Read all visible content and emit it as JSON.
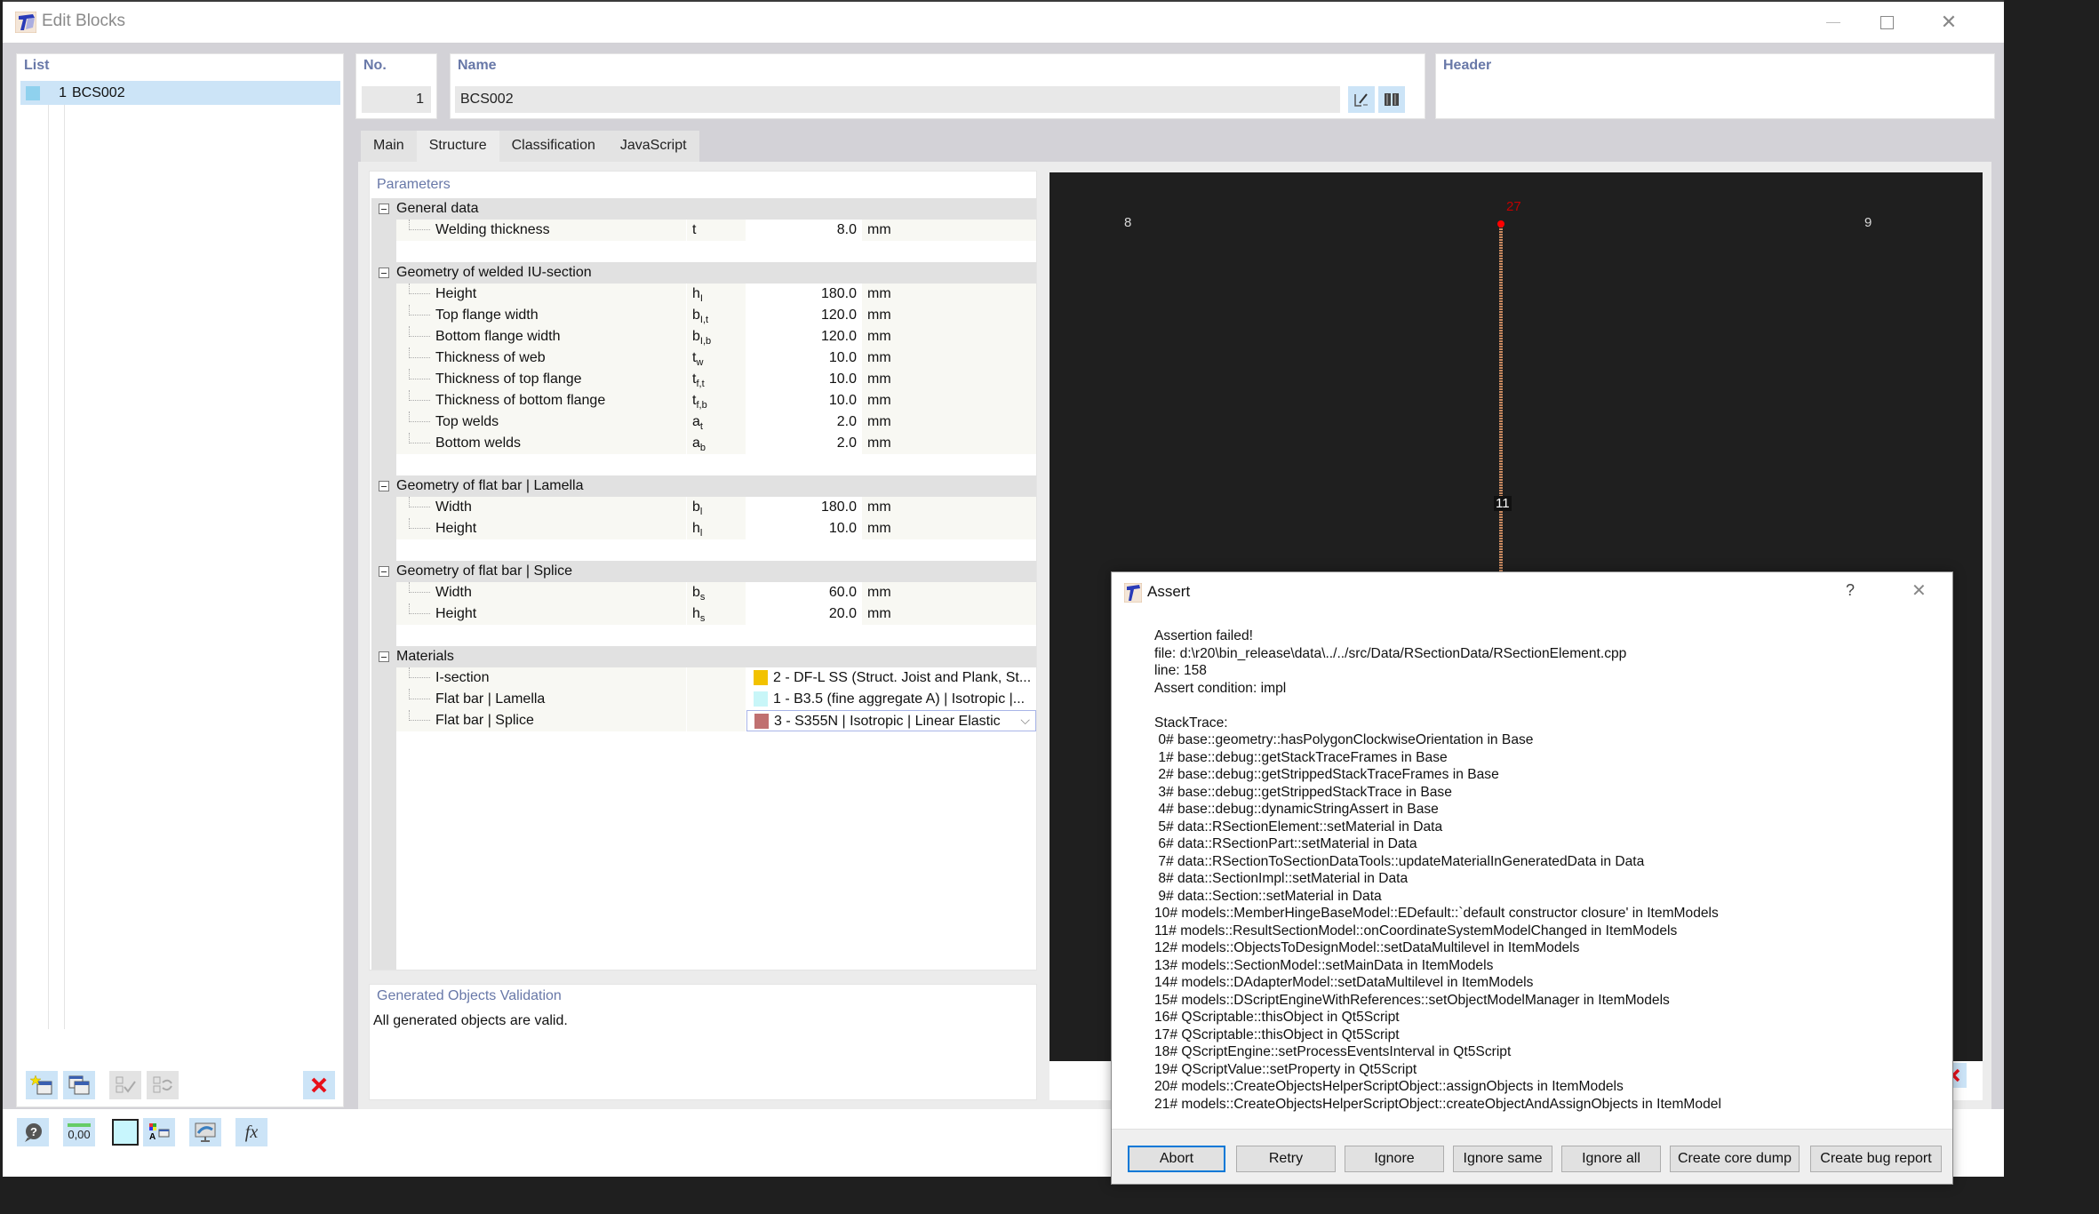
{
  "window": {
    "title": "Edit Blocks",
    "controls": [
      "minimize",
      "maximize",
      "close"
    ]
  },
  "list": {
    "label": "List",
    "items": [
      {
        "number": "1",
        "name": "BCS002",
        "color": "#8fd1ee"
      }
    ],
    "toolbar": [
      {
        "icon": "new-item-icon",
        "enabled": true
      },
      {
        "icon": "copy-item-icon",
        "enabled": true
      },
      {
        "icon": "check-all-icon",
        "enabled": false
      },
      {
        "icon": "toggle-selection-icon",
        "enabled": false
      },
      {
        "icon": "delete-icon",
        "enabled": true
      }
    ]
  },
  "fields": {
    "no_label": "No.",
    "no_value": "1",
    "name_label": "Name",
    "name_value": "BCS002",
    "header_label": "Header"
  },
  "tabs": [
    {
      "label": "Main",
      "active": false
    },
    {
      "label": "Structure",
      "active": true
    },
    {
      "label": "Classification",
      "active": false
    },
    {
      "label": "JavaScript",
      "active": false
    }
  ],
  "parameters": {
    "label": "Parameters",
    "groups": [
      {
        "title": "General data",
        "rows": [
          {
            "label": "Welding thickness",
            "symbol": "t",
            "sub": "",
            "value": "8.0",
            "unit": "mm"
          }
        ]
      },
      {
        "title": "Geometry of welded IU-section",
        "rows": [
          {
            "label": "Height",
            "symbol": "h",
            "sub": "I",
            "value": "180.0",
            "unit": "mm"
          },
          {
            "label": "Top flange width",
            "symbol": "b",
            "sub": "I,t",
            "value": "120.0",
            "unit": "mm"
          },
          {
            "label": "Bottom flange width",
            "symbol": "b",
            "sub": "I,b",
            "value": "120.0",
            "unit": "mm"
          },
          {
            "label": "Thickness of web",
            "symbol": "t",
            "sub": "w",
            "value": "10.0",
            "unit": "mm"
          },
          {
            "label": "Thickness of top flange",
            "symbol": "t",
            "sub": "f,t",
            "value": "10.0",
            "unit": "mm"
          },
          {
            "label": "Thickness of bottom flange",
            "symbol": "t",
            "sub": "f,b",
            "value": "10.0",
            "unit": "mm"
          },
          {
            "label": "Top welds",
            "symbol": "a",
            "sub": "t",
            "value": "2.0",
            "unit": "mm"
          },
          {
            "label": "Bottom welds",
            "symbol": "a",
            "sub": "b",
            "value": "2.0",
            "unit": "mm"
          }
        ]
      },
      {
        "title": "Geometry of flat bar | Lamella",
        "rows": [
          {
            "label": "Width",
            "symbol": "b",
            "sub": "l",
            "value": "180.0",
            "unit": "mm"
          },
          {
            "label": "Height",
            "symbol": "h",
            "sub": "l",
            "value": "10.0",
            "unit": "mm"
          }
        ]
      },
      {
        "title": "Geometry of flat bar | Splice",
        "rows": [
          {
            "label": "Width",
            "symbol": "b",
            "sub": "s",
            "value": "60.0",
            "unit": "mm"
          },
          {
            "label": "Height",
            "symbol": "h",
            "sub": "s",
            "value": "20.0",
            "unit": "mm"
          }
        ]
      },
      {
        "title": "Materials",
        "materials": [
          {
            "label": "I-section",
            "value": "2 - DF-L SS (Struct. Joist and Plank, St...",
            "color": "#f2c200",
            "selected": false
          },
          {
            "label": "Flat bar | Lamella",
            "value": "1 - B3.5 (fine aggregate A) | Isotropic |...",
            "color": "#c8f6f8",
            "selected": false
          },
          {
            "label": "Flat bar | Splice",
            "value": "3 - S355N | Isotropic | Linear Elastic",
            "color": "#c07070",
            "selected": true
          }
        ]
      }
    ]
  },
  "validation": {
    "label": "Generated Objects Validation",
    "message": "All generated objects are valid."
  },
  "viewport": {
    "nodes": [
      {
        "id": "8",
        "color": "#d8d8d8"
      },
      {
        "id": "27",
        "color": "#c00000"
      },
      {
        "id": "9",
        "color": "#d8d8d8"
      },
      {
        "id": "11",
        "color": "#ffffff"
      }
    ],
    "member_color": "#c98a60",
    "selected_node_color": "#ff0000"
  },
  "bottom_toolbar": [
    {
      "icon": "help-icon"
    },
    {
      "icon": "decimal-places-icon",
      "text": "0,00"
    },
    {
      "icon": "color-swatch-icon"
    },
    {
      "icon": "display-properties-icon"
    },
    {
      "icon": "view-3d-icon"
    },
    {
      "icon": "formula-icon",
      "text": "fx"
    }
  ],
  "assert_dialog": {
    "title": "Assert",
    "help": "?",
    "lines": [
      "Assertion failed!",
      "file: d:\\r20\\bin_release\\data\\../../src/Data/RSectionData/RSectionElement.cpp",
      "line: 158",
      "Assert condition: impl",
      "",
      "StackTrace:",
      " 0# base::geometry::hasPolygonClockwiseOrientation in Base",
      " 1# base::debug::getStackTraceFrames in Base",
      " 2# base::debug::getStrippedStackTraceFrames in Base",
      " 3# base::debug::getStrippedStackTrace in Base",
      " 4# base::debug::dynamicStringAssert in Base",
      " 5# data::RSectionElement::setMaterial in Data",
      " 6# data::RSectionPart::setMaterial in Data",
      " 7# data::RSectionToSectionDataTools::updateMaterialInGeneratedData in Data",
      " 8# data::SectionImpl::setMaterial in Data",
      " 9# data::Section::setMaterial in Data",
      "10# models::MemberHingeBaseModel::EDefault::`default constructor closure' in ItemModels",
      "11# models::ResultSectionModel::onCoordinateSystemModelChanged in ItemModels",
      "12# models::ObjectsToDesignModel::setDataMultilevel in ItemModels",
      "13# models::SectionModel::setMainData in ItemModels",
      "14# models::DAdapterModel::setDataMultilevel in ItemModels",
      "15# models::DScriptEngineWithReferences::setObjectModelManager in ItemModels",
      "16# QScriptable::thisObject in Qt5Script",
      "17# QScriptable::thisObject in Qt5Script",
      "18# QScriptEngine::setProcessEventsInterval in Qt5Script",
      "19# QScriptValue::setProperty in Qt5Script",
      "20# models::CreateObjectsHelperScriptObject::assignObjects in ItemModels",
      "21# models::CreateObjectsHelperScriptObject::createObjectAndAssignObjects in ItemModel"
    ],
    "buttons": [
      {
        "label": "Abort",
        "default": true
      },
      {
        "label": "Retry",
        "default": false
      },
      {
        "label": "Ignore",
        "default": false
      },
      {
        "label": "Ignore same",
        "default": false
      },
      {
        "label": "Ignore all",
        "default": false
      },
      {
        "label": "Create core dump",
        "default": false
      },
      {
        "label": "Create bug report",
        "default": false
      }
    ]
  }
}
